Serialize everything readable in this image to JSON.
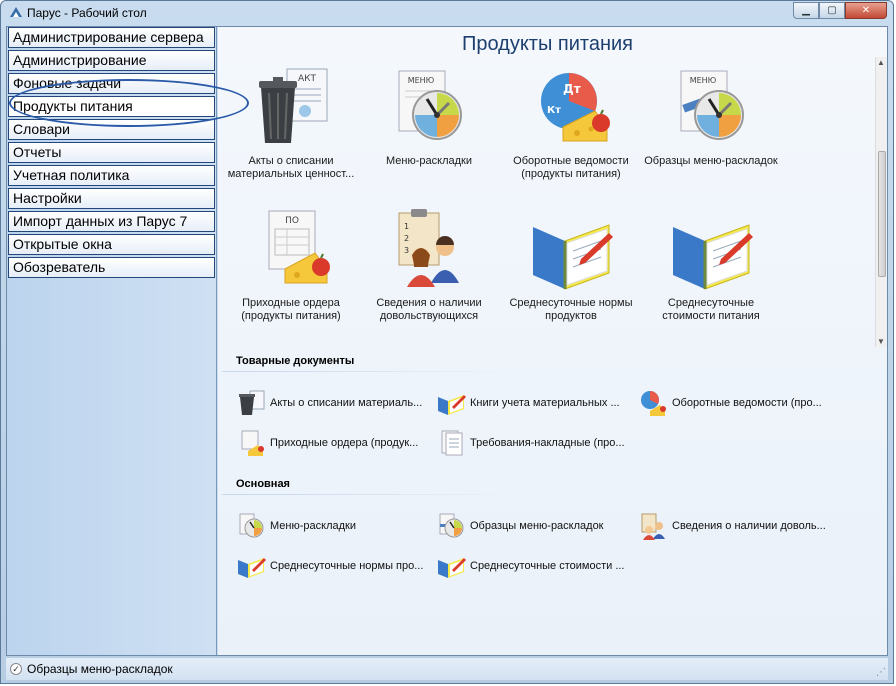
{
  "window": {
    "title": "Парус - Рабочий стол",
    "minimize": "▁",
    "maximize": "▢",
    "close": "✕"
  },
  "nav": {
    "items": [
      {
        "label": "Администрирование сервера"
      },
      {
        "label": "Администрирование"
      },
      {
        "label": "Фоновые задачи"
      },
      {
        "label": "Продукты питания"
      },
      {
        "label": "Словари"
      },
      {
        "label": "Отчеты"
      },
      {
        "label": "Учетная политика"
      },
      {
        "label": "Настройки"
      },
      {
        "label": "Импорт данных из Парус 7"
      },
      {
        "label": "Открытые окна"
      },
      {
        "label": "Обозреватель"
      }
    ],
    "active_index": 3
  },
  "main": {
    "title": "Продукты питания",
    "tiles": [
      {
        "label": "Акты о списании\nматериальных ценност...",
        "icon": "trash-document-icon",
        "badge": "АКТ"
      },
      {
        "label": "Меню-раскладки",
        "icon": "menu-scale-icon",
        "badge": "МЕНЮ"
      },
      {
        "label": "Оборотные ведомости\n(продукты питания)",
        "icon": "debit-credit-cheese-icon",
        "badge_dt": "Дт",
        "badge_kt": "Кт"
      },
      {
        "label": "Образцы меню-раскладок",
        "icon": "menu-sample-icon",
        "badge": "МЕНЮ"
      },
      {
        "label": "Приходные ордера\n(продукты питания)",
        "icon": "receipt-order-cheese-icon",
        "badge": "ПО"
      },
      {
        "label": "Сведения о наличии\nдовольствующихся",
        "icon": "people-checklist-icon"
      },
      {
        "label": "Среднесуточные нормы\nпродуктов",
        "icon": "notebook-pencil-icon"
      },
      {
        "label": "Среднесуточные\nстоимости питания",
        "icon": "notebook-pencil-icon"
      }
    ],
    "sections": [
      {
        "title": "Товарные документы",
        "items": [
          {
            "label": "Акты о списании материаль...",
            "icon": "trash-document-icon"
          },
          {
            "label": "Книги учета материальных ...",
            "icon": "notebook-pencil-icon"
          },
          {
            "label": "Оборотные ведомости (про...",
            "icon": "debit-credit-cheese-icon"
          },
          {
            "label": "Приходные ордера (продук...",
            "icon": "receipt-order-cheese-icon"
          },
          {
            "label": "Требования-накладные (про...",
            "icon": "requisition-document-icon"
          }
        ]
      },
      {
        "title": "Основная",
        "items": [
          {
            "label": "Меню-раскладки",
            "icon": "menu-scale-icon"
          },
          {
            "label": "Образцы меню-раскладок",
            "icon": "menu-sample-icon"
          },
          {
            "label": "Сведения о наличии доволь...",
            "icon": "people-checklist-icon"
          },
          {
            "label": "Среднесуточные нормы про...",
            "icon": "notebook-pencil-icon"
          },
          {
            "label": "Среднесуточные стоимости ...",
            "icon": "notebook-pencil-icon"
          }
        ]
      }
    ]
  },
  "statusbar": {
    "text": "Образцы меню-раскладок"
  },
  "colors": {
    "accent": "#1c3f6e",
    "nav_border": "#24477a",
    "highlight_ellipse": "#2a5aa8"
  }
}
